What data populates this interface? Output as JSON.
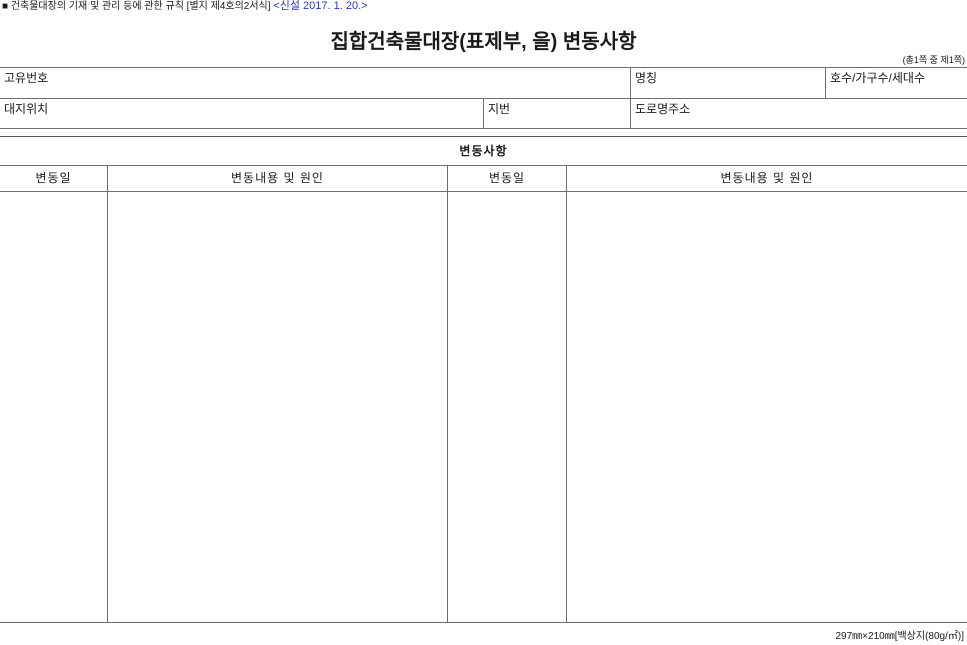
{
  "header": {
    "form_ref": "■ 건축물대장의 기재 및 관리 등에 관한 규칙 [별지 제4호의2서식]",
    "amend_note": "<신설 2017. 1. 20.>",
    "title": "집합건축물대장(표제부, 을) 변동사항",
    "page_info": "(총1쪽 중 제1쪽)"
  },
  "info_fields": {
    "unique_no_label": "고유번호",
    "name_label": "명칭",
    "units_label": "호수/가구수/세대수",
    "site_location_label": "대지위치",
    "lot_no_label": "지번",
    "road_address_label": "도로명주소"
  },
  "changes": {
    "section_title": "변동사항",
    "columns": [
      "변동일",
      "변동내용 및 원인",
      "변동일",
      "변동내용 및 원인"
    ]
  },
  "footer": {
    "paper_spec": "297㎜×210㎜[백상지(80g/㎡)]"
  },
  "colors": {
    "amend_note": "#2b36c9",
    "rule_lines": "#6e6e6e"
  }
}
